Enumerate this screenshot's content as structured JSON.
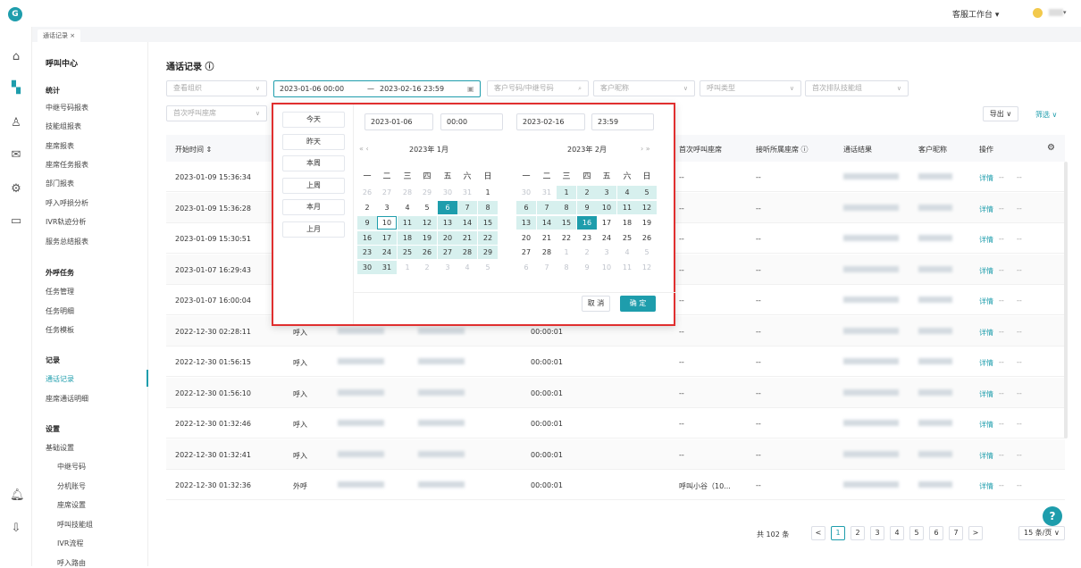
{
  "topbar": {
    "logo": "G",
    "workbench": "客服工作台 ▾",
    "user_dropdown": "▾"
  },
  "tab": {
    "label": "通话记录 ×"
  },
  "sidebar": {
    "title": "呼叫中心",
    "groups": [
      {
        "label": "统计",
        "items": [
          "中继号码报表",
          "技能组报表",
          "座席报表",
          "座席任务报表",
          "部门报表",
          "呼入呼损分析",
          "IVR轨迹分析",
          "服务总结报表"
        ]
      },
      {
        "label": "外呼任务",
        "items": [
          "任务管理",
          "任务明细",
          "任务模板"
        ]
      },
      {
        "label": "记录",
        "items": [
          "通话记录",
          "座席通话明细"
        ]
      },
      {
        "label": "设置",
        "items": [
          "基础设置",
          "中继号码",
          "分机账号",
          "座席设置",
          "呼叫技能组",
          "IVR流程",
          "呼入路由"
        ]
      }
    ]
  },
  "main": {
    "title": "通话记录 ⓘ",
    "filters": {
      "org": "查看组织",
      "date_start": "2023-01-06 00:00",
      "date_sep": "—",
      "date_end": "2023-02-16 23:59",
      "number": "客户号码/中继号码",
      "nickname": "客户昵称",
      "calltype": "呼叫类型",
      "skill": "首次排队技能组",
      "seat": "首次呼叫座席"
    },
    "export": "导出 ∨",
    "screen": "筛选 ∨",
    "columns": {
      "start": "开始时间 ⇕",
      "first_seat": "首次呼叫座席",
      "listen_seat": "接听所属座席 ⓘ",
      "result": "通话结果",
      "nickname": "客户昵称",
      "op": "操作"
    },
    "rows": [
      {
        "time": "2023-01-09 15:36:34",
        "dir": "",
        "dur": "",
        "seat": "--",
        "seat2": "--"
      },
      {
        "time": "2023-01-09 15:36:28",
        "dir": "",
        "dur": "",
        "seat": "--",
        "seat2": "--"
      },
      {
        "time": "2023-01-09 15:30:51",
        "dir": "",
        "dur": "",
        "seat": "--",
        "seat2": "--"
      },
      {
        "time": "2023-01-07 16:29:43",
        "dir": "",
        "dur": "",
        "seat": "--",
        "seat2": "--"
      },
      {
        "time": "2023-01-07 16:00:04",
        "dir": "",
        "dur": "",
        "seat": "--",
        "seat2": "--"
      },
      {
        "time": "2022-12-30 02:28:11",
        "dir": "呼入",
        "dur": "00:00:01",
        "seat": "--",
        "seat2": "--"
      },
      {
        "time": "2022-12-30 01:56:15",
        "dir": "呼入",
        "dur": "00:00:01",
        "seat": "--",
        "seat2": "--"
      },
      {
        "time": "2022-12-30 01:56:10",
        "dir": "呼入",
        "dur": "00:00:01",
        "seat": "--",
        "seat2": "--"
      },
      {
        "time": "2022-12-30 01:32:46",
        "dir": "呼入",
        "dur": "00:00:01",
        "seat": "--",
        "seat2": "--"
      },
      {
        "time": "2022-12-30 01:32:41",
        "dir": "呼入",
        "dur": "00:00:01",
        "seat": "--",
        "seat2": "--"
      },
      {
        "time": "2022-12-30 01:32:36",
        "dir": "外呼",
        "dur": "00:00:01",
        "seat": "呼叫小谷（10...",
        "seat2": "--"
      }
    ],
    "detail": "详情",
    "dash": "--",
    "pager": {
      "total": "共 102 条",
      "prev": "<",
      "next": ">",
      "pages": [
        "1",
        "2",
        "3",
        "4",
        "5",
        "6",
        "7"
      ],
      "size": "15 条/页 ∨"
    }
  },
  "picker": {
    "shortcuts": [
      "今天",
      "昨天",
      "本周",
      "上周",
      "本月",
      "上月"
    ],
    "start_date": "2023-01-06",
    "start_time": "00:00",
    "end_date": "2023-02-16",
    "end_time": "23:59",
    "left_title": "2023年 1月",
    "right_title": "2023年 2月",
    "prev_nav": "«  ‹",
    "next_nav": "›  »",
    "weekdays": [
      "一",
      "二",
      "三",
      "四",
      "五",
      "六",
      "日"
    ],
    "cancel": "取 消",
    "ok": "确 定"
  }
}
